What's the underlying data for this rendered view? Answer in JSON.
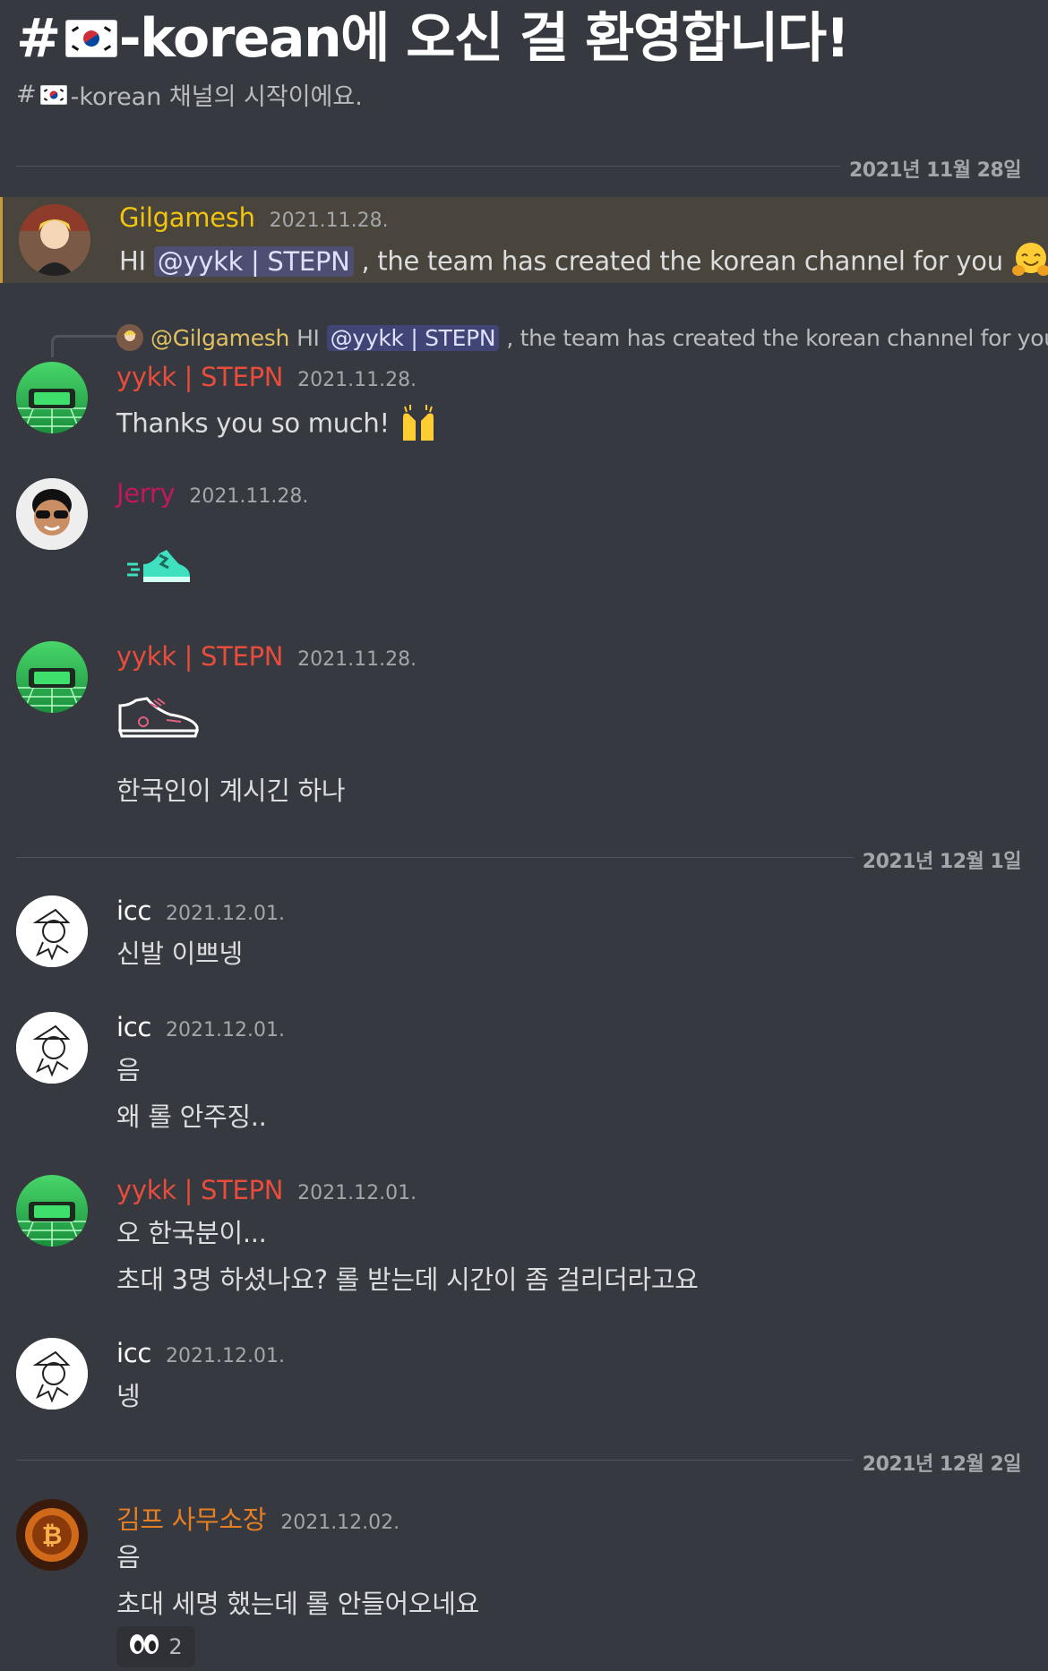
{
  "header": {
    "welcome_hash": "#",
    "welcome_text": "-korean에 오신 걸 환영합니다!",
    "subtitle_hash": "#",
    "subtitle_text": "-korean 채널의 시작이에요."
  },
  "dividers": [
    "2021년 11월 28일",
    "2021년 12월 1일",
    "2021년 12월 2일"
  ],
  "colors": {
    "background": "#36393f",
    "gilgamesh": "#f1c40f",
    "yykk": "#e74c3c",
    "jerry": "#c2185b",
    "icc": "#ffffff",
    "gimpo": "#e67e22",
    "mention_bg": "#5865f2"
  },
  "messages": [
    {
      "author": "Gilgamesh",
      "time": "2021.11.28.",
      "text_pre": "HI",
      "mention": "@yykk | STEPN",
      "text_post": ", the team has created the korean channel for you",
      "emoji": "hugging-face"
    },
    {
      "reply": {
        "author": "@Gilgamesh",
        "text_pre": "HI",
        "mention": "@yykk | STEPN",
        "text_post": ", the team has created the korean channel for you"
      },
      "author": "yykk | STEPN",
      "time": "2021.11.28.",
      "text": "Thanks you so much!",
      "emoji": "raising-hands"
    },
    {
      "author": "Jerry",
      "time": "2021.11.28.",
      "sticker": "running-sneaker"
    },
    {
      "author": "yykk | STEPN",
      "time": "2021.11.28.",
      "sticker": "sneaker-outline",
      "text": "한국인이 계시긴 하나"
    },
    {
      "author": "icc",
      "time": "2021.12.01.",
      "text": "신발 이쁘넹"
    },
    {
      "author": "icc",
      "time": "2021.12.01.",
      "lines": [
        "음",
        "왜 롤 안주징.."
      ]
    },
    {
      "author": "yykk | STEPN",
      "time": "2021.12.01.",
      "lines": [
        "오 한국분이...",
        "초대 3명 하셨나요? 롤 받는데 시간이 좀 걸리더라고요"
      ]
    },
    {
      "author": "icc",
      "time": "2021.12.01.",
      "text": "넹"
    },
    {
      "author": "김프 사무소장",
      "time": "2021.12.02.",
      "lines": [
        "음",
        "초대 세명 했는데 롤 안들어오네요"
      ],
      "reaction": {
        "emoji": "eyes",
        "count": "2"
      }
    }
  ]
}
